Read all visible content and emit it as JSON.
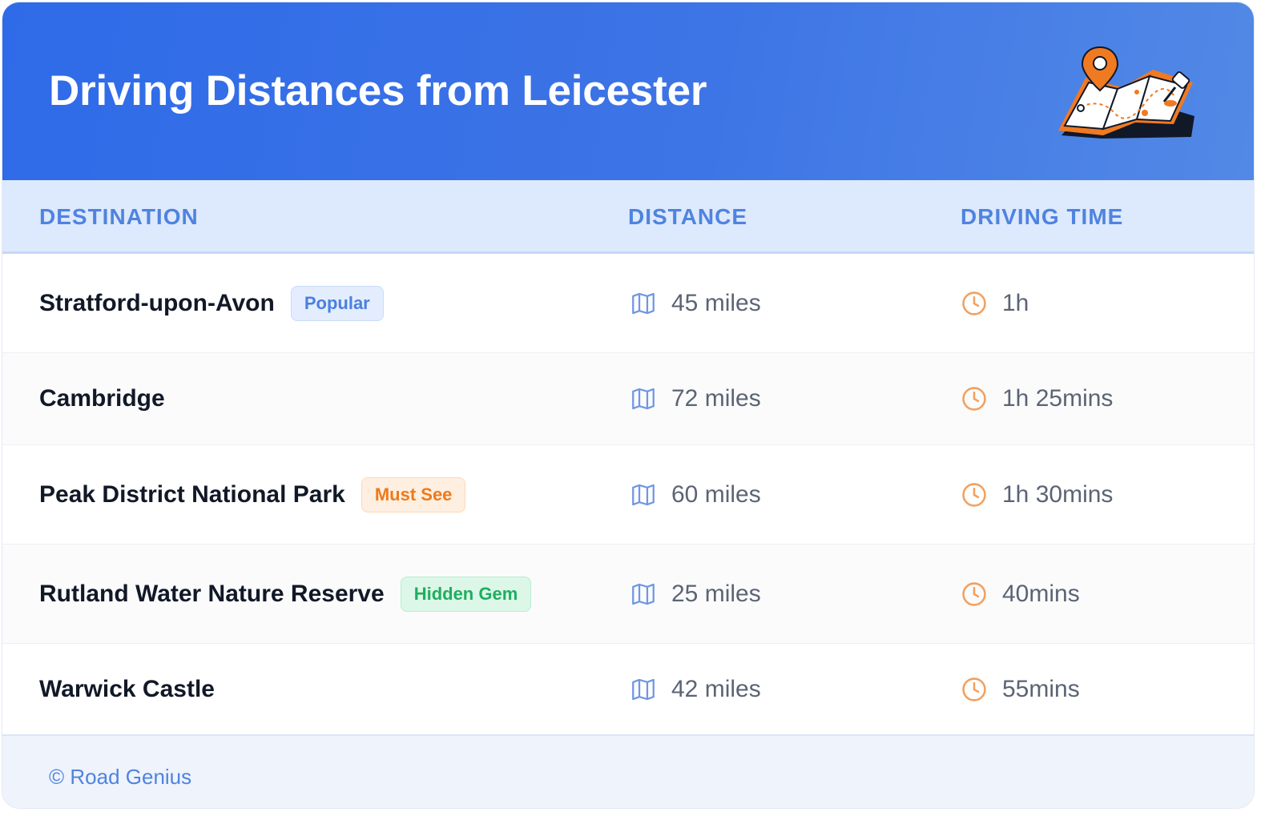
{
  "header": {
    "title": "Driving Distances from Leicester",
    "illustration_icon": "folded-map-with-location-pin-icon"
  },
  "columns": {
    "destination": "DESTINATION",
    "distance": "DISTANCE",
    "driving_time": "DRIVING TIME"
  },
  "rows": [
    {
      "destination": "Stratford-upon-Avon",
      "badge": "Popular",
      "badge_color": "#4a7fe0",
      "distance": "45 miles",
      "time": "1h"
    },
    {
      "destination": "Cambridge",
      "badge": "",
      "distance": "72 miles",
      "time": "1h 25mins"
    },
    {
      "destination": "Peak District National Park",
      "badge": "Must See",
      "badge_color": "#ed7a1c",
      "distance": "60 miles",
      "time": "1h 30mins"
    },
    {
      "destination": "Rutland Water Nature Reserve",
      "badge": "Hidden Gem",
      "badge_color": "#1fae5e",
      "distance": "25 miles",
      "time": "40mins"
    },
    {
      "destination": "Warwick Castle",
      "badge": "",
      "distance": "42 miles",
      "time": "55mins"
    }
  ],
  "icons": {
    "distance": "map-icon",
    "time": "clock-icon"
  },
  "colors": {
    "header_gradient_start": "#2f6be8",
    "header_gradient_end": "#5289e6",
    "accent": "#4f83e0",
    "clock": "#f2a05e"
  },
  "footer": {
    "text": "© Road Genius"
  }
}
